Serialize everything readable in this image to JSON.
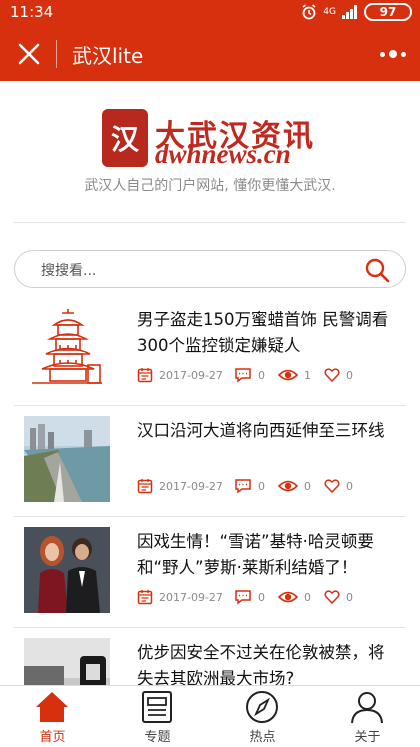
{
  "status_bar": {
    "time": "11:34",
    "signal": "4G",
    "battery": "97"
  },
  "nav": {
    "title": "武汉lite"
  },
  "brand": {
    "logo_cn": "大武汉资讯",
    "logo_en": "dwhnews.cn",
    "tagline": "武汉人自己的门户网站, 懂你更懂大武汉."
  },
  "search": {
    "placeholder": "搜搜看..."
  },
  "news": [
    {
      "title": "男子盗走150万蜜蜡首饰 民警调看300个监控锁定嫌疑人",
      "date": "2017-09-27",
      "comments": "0",
      "views": "1",
      "likes": "0",
      "thumb": "tower-illustration"
    },
    {
      "title": "汉口沿河大道将向西延伸至三环线",
      "date": "2017-09-27",
      "comments": "0",
      "views": "0",
      "likes": "0",
      "thumb": "riverside-road-photo"
    },
    {
      "title": "因戏生情！“雪诺”基特·哈灵顿要和“野人”萝斯·莱斯利结婚了！",
      "date": "2017-09-27",
      "comments": "0",
      "views": "0",
      "likes": "0",
      "thumb": "couple-photo"
    },
    {
      "title": "优步因安全不过关在伦敦被禁，将失去其欧洲最大市场?",
      "date": "",
      "comments": "",
      "views": "",
      "likes": "",
      "thumb": "uber-photo"
    }
  ],
  "tabs": [
    {
      "label": "首页",
      "icon": "home-icon",
      "active": true
    },
    {
      "label": "专题",
      "icon": "article-icon",
      "active": false
    },
    {
      "label": "热点",
      "icon": "compass-icon",
      "active": false
    },
    {
      "label": "关于",
      "icon": "user-icon",
      "active": false
    }
  ],
  "colors": {
    "brand_red": "#d6300f",
    "meta_gray": "#8a8a8a",
    "divider": "#e3e3e3"
  }
}
